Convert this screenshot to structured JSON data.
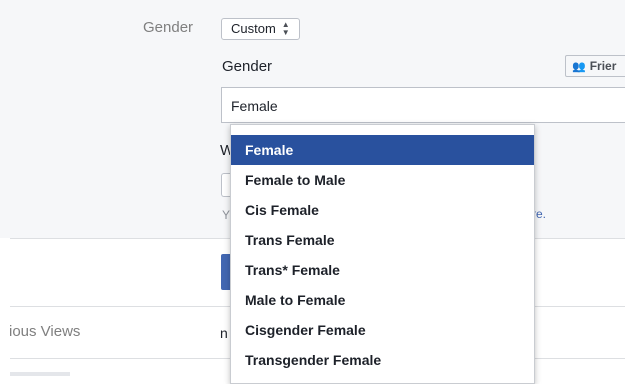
{
  "gender_row": {
    "label": "Gender",
    "select_value": "Custom"
  },
  "custom_gender": {
    "heading": "Gender",
    "input_value": "Female",
    "audience_button": "Frier"
  },
  "hidden_behind_dropdown": {
    "w_text": "W",
    "y_text": "Y",
    "re_text": "re."
  },
  "dropdown": {
    "options": [
      "Female",
      "Female to Male",
      "Cis Female",
      "Trans Female",
      "Trans* Female",
      "Male to Female",
      "Cisgender Female",
      "Transgender Female"
    ],
    "selected_index": 0
  },
  "rows_below": {
    "previous_views_label": "ious Views",
    "previous_views_value": "n"
  },
  "colors": {
    "highlight": "#29519e",
    "link": "#4267b2",
    "label_gray": "#7f7f7f"
  }
}
